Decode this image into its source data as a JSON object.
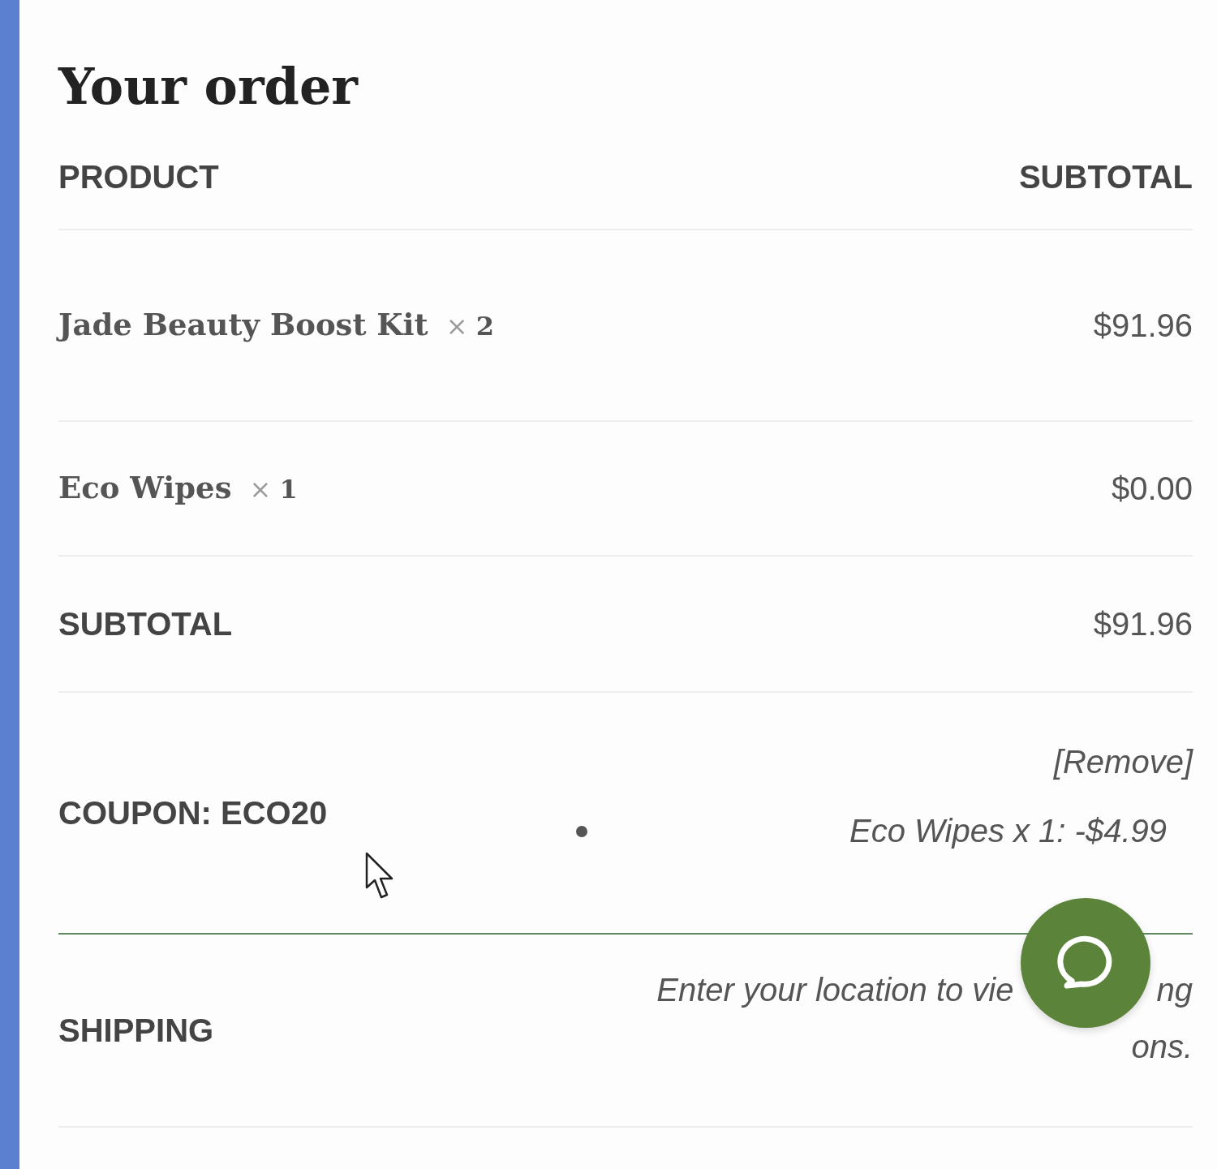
{
  "title": "Your order",
  "columns": [
    "PRODUCT",
    "SUBTOTAL"
  ],
  "items": [
    {
      "name": "Jade Beauty Boost Kit",
      "quantity": "× **2**",
      "price": "$91.96"
    },
    {
      "name": "Eco Wipes",
      "quantity": "× **1**",
      "price": "$0.00"
    }
  ],
  "subtotal": {
    "label": "SUBTOTAL",
    "value": "$91.96"
  },
  "coupon": {
    "label": "COUPON: ECO20",
    "remove_link": "[Remove]",
    "discounts": [
      "Eco Wipes x 1: -$4.99"
    ]
  },
  "shipping": {
    "label": "SHIPPING",
    "note_visible_parts": [
      "Enter your location to vie",
      "ng",
      "ons."
    ]
  }
}
